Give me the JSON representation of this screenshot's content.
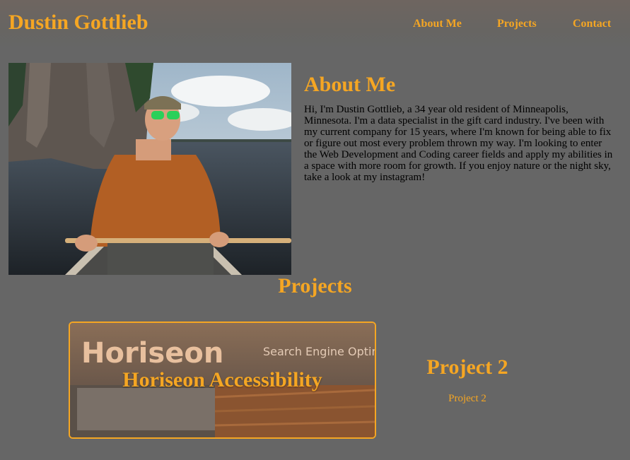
{
  "header": {
    "title": "Dustin Gottlieb",
    "nav": [
      "About Me",
      "Projects",
      "Contact"
    ]
  },
  "about": {
    "heading": "About Me",
    "bio": "Hi, I'm Dustin Gottlieb, a 34 year old resident of Minneapolis, Minnesota. I'm a data specialist in the gift card industry. I've been with my current company for 15 years, where I'm known for being able to fix or figure out most every problem thrown my way. I'm looking to enter the Web Development and Coding career fields and apply my abilities in a space with more room for growth. If you enjoy nature or the night sky, take a look at my instagram!"
  },
  "projects": {
    "heading": "Projects",
    "card1": {
      "title": "Horiseon Accessibility",
      "screenshot_logo": "Horiseon",
      "screenshot_nav": "Search Engine Optin"
    },
    "card2": {
      "title": "Project 2",
      "link": "Project 2"
    }
  },
  "colors": {
    "accent": "#f5a623",
    "background": "#666666",
    "text": "#000000"
  }
}
